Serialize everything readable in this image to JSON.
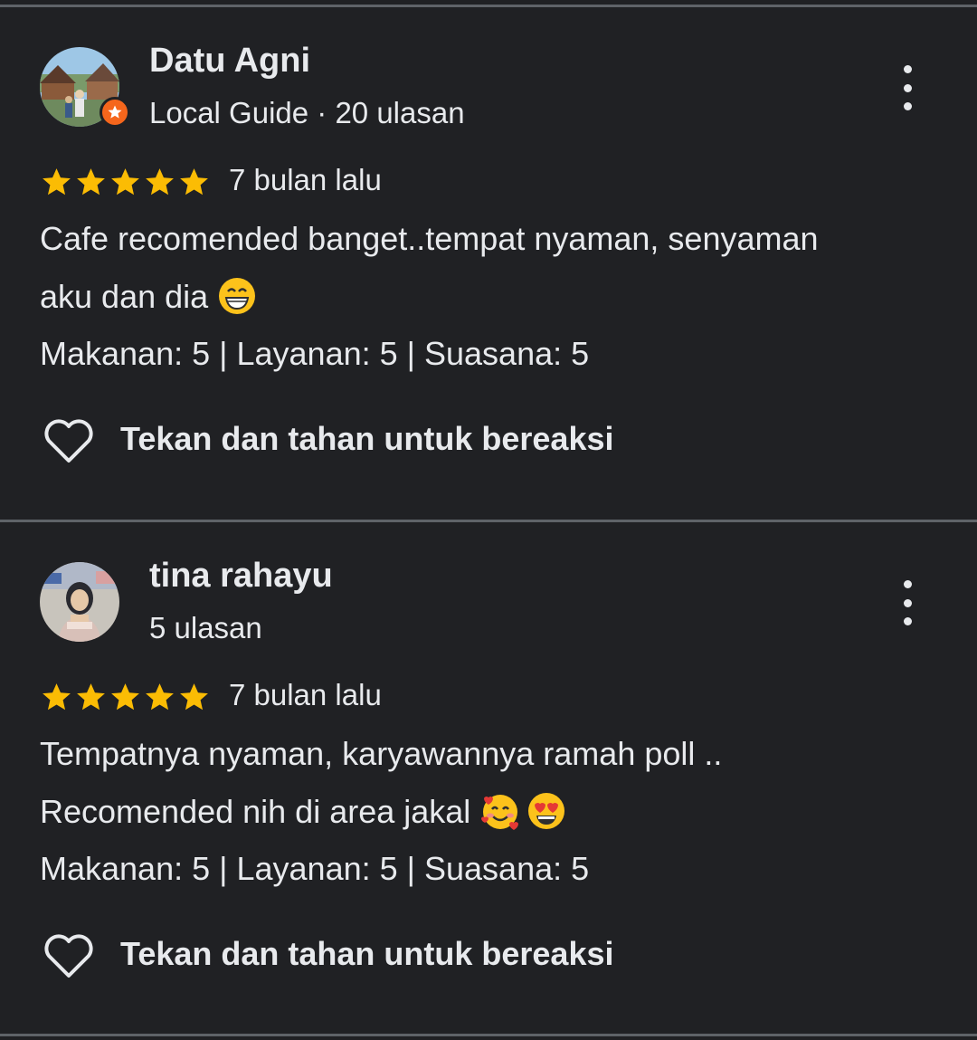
{
  "reviews": [
    {
      "name": "Datu Agni",
      "meta": "Local Guide · 20 ulasan",
      "is_local_guide": true,
      "rating": 5,
      "date": "7 bulan lalu",
      "text_line1": "Cafe recomended banget..tempat nyaman, senyaman",
      "text_line2": "aku dan dia",
      "text_line2_emojis": [
        "grinning-face-emoji"
      ],
      "subratings": "Makanan: 5 | Layanan: 5 | Suasana: 5",
      "react_label": "Tekan dan tahan untuk bereaksi"
    },
    {
      "name": "tina rahayu",
      "meta": "5 ulasan",
      "is_local_guide": false,
      "rating": 5,
      "date": "7 bulan lalu",
      "text_line1": "Tempatnya nyaman, karyawannya ramah poll ..",
      "text_line2": "Recomended nih di area jakal",
      "text_line2_emojis": [
        "smiling-face-with-hearts-emoji",
        "heart-eyes-emoji"
      ],
      "subratings": "Makanan: 5 | Layanan: 5 | Suasana: 5",
      "react_label": "Tekan dan tahan untuk bereaksi"
    }
  ],
  "colors": {
    "background": "#202124",
    "text": "#e8eaed",
    "divider": "#5f6368",
    "star": "#fbbc04",
    "local_guide_badge": "#f5661c"
  },
  "icons": {
    "more": "more-vert-icon",
    "react": "heart-outline-icon",
    "star": "star-icon",
    "badge": "local-guide-star-icon"
  }
}
